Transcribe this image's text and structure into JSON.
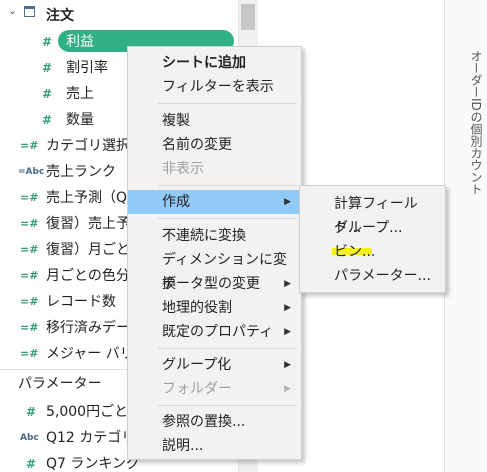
{
  "tree": {
    "table_name": "注文",
    "fields": [
      {
        "icon": "#",
        "label": "利益"
      },
      {
        "icon": "#",
        "label": "割引率"
      },
      {
        "icon": "#",
        "label": "売上"
      },
      {
        "icon": "#",
        "label": "数量"
      },
      {
        "icon": "=#",
        "label": "カテゴリ選択"
      },
      {
        "icon": "=Abc",
        "label": "売上ランク"
      },
      {
        "icon": "=#",
        "label": "売上予測（Q"
      },
      {
        "icon": "=#",
        "label": "復習）売上予"
      },
      {
        "icon": "=#",
        "label": "復習）月ごと"
      },
      {
        "icon": "=#",
        "label": "月ごとの色分"
      },
      {
        "icon": "=#",
        "label": "レコード数"
      },
      {
        "icon": "=#",
        "label": "移行済みデー"
      },
      {
        "icon": "=#",
        "label": "メジャー バリュ"
      }
    ],
    "params_title": "パラメーター",
    "params": [
      {
        "icon": "#",
        "label": "5,000円ごと"
      },
      {
        "icon": "Abc",
        "label": "Q12 カテゴリ"
      },
      {
        "icon": "#",
        "label": "Q7 ランキング"
      }
    ]
  },
  "right_vertical_text": "オーダーIDの個別カウント",
  "context_menu": {
    "items": [
      {
        "label": "シートに追加",
        "bold": true
      },
      {
        "label": "フィルターを表示"
      },
      {
        "label": "複製"
      },
      {
        "label": "名前の変更"
      },
      {
        "label": "非表示",
        "disabled": true
      },
      {
        "label": "作成",
        "submenu": true,
        "highlighted": true
      },
      {
        "label": "不連続に変換"
      },
      {
        "label": "ディメンションに変換"
      },
      {
        "label": "データ型の変更",
        "submenu": true
      },
      {
        "label": "地理的役割",
        "submenu": true
      },
      {
        "label": "既定のプロパティ",
        "submenu": true
      },
      {
        "label": "グループ化",
        "submenu": true
      },
      {
        "label": "フォルダー",
        "submenu": true,
        "disabled": true
      },
      {
        "label": "参照の置換..."
      },
      {
        "label": "説明..."
      }
    ]
  },
  "submenu": {
    "items": [
      {
        "label": "計算フィールド..."
      },
      {
        "label": "グループ..."
      },
      {
        "label": "ビン..."
      },
      {
        "label": "パラメーター..."
      }
    ]
  },
  "colors": {
    "selection": "#2fb085",
    "menu_highlight": "#91c9f7",
    "marker": "#f4f000"
  }
}
